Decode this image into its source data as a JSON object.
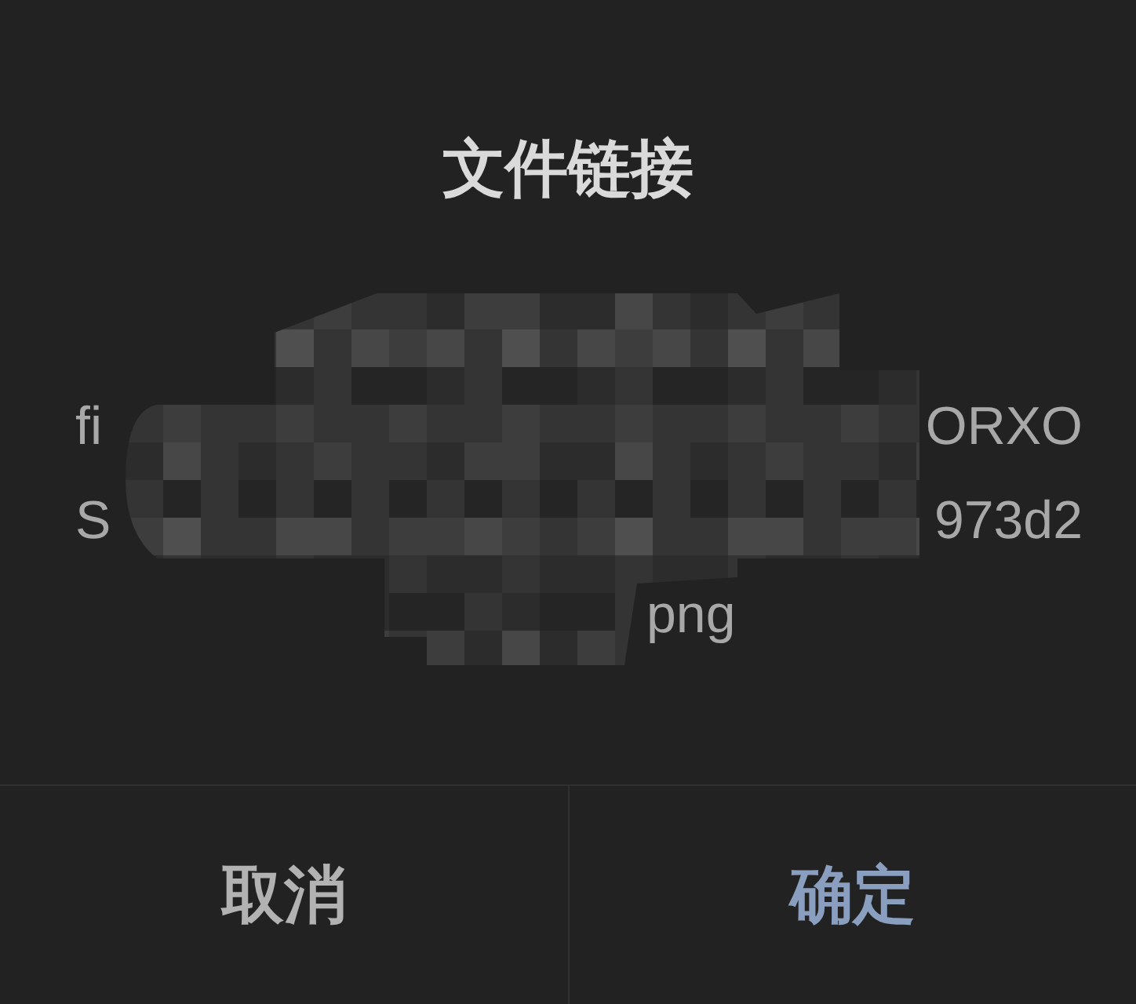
{
  "dialog": {
    "title": "文件链接",
    "link": {
      "redacted": true,
      "lines": [
        {
          "start": "fi",
          "end": "ORXO"
        },
        {
          "start": "S",
          "end": "973d2"
        },
        {
          "end": "png"
        }
      ]
    },
    "buttons": [
      {
        "label": "取消",
        "kind": "cancel"
      },
      {
        "label": "确定",
        "kind": "confirm"
      }
    ]
  }
}
